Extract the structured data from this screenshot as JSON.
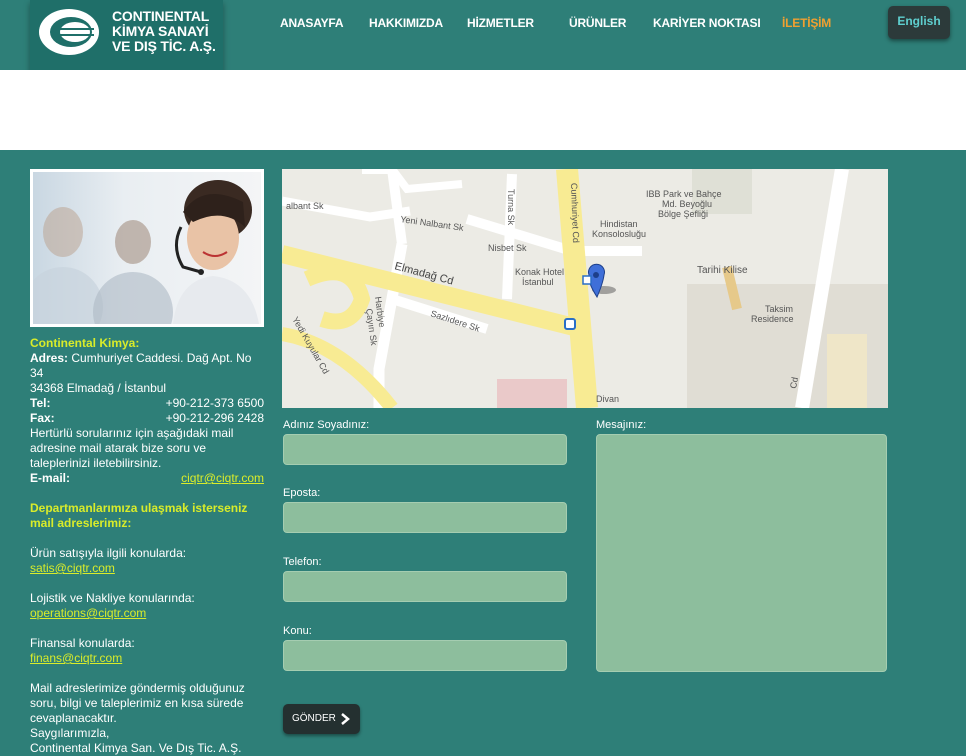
{
  "logo": {
    "line1": "CONTINENTAL",
    "line2": "KİMYA SANAYİ",
    "line3": "VE DIŞ TİC. A.Ş."
  },
  "nav": [
    {
      "label": "ANASAYFA",
      "active": false
    },
    {
      "label": "HAKKIMIZDA",
      "active": false
    },
    {
      "label": "HİZMETLER",
      "active": false
    },
    {
      "label": "ÜRÜNLER",
      "active": false
    },
    {
      "label": "KARİYER NOKTASI",
      "active": false
    },
    {
      "label": "İLETİŞİM",
      "active": true
    }
  ],
  "language_button": "English",
  "contact": {
    "company": "Continental Kimya:",
    "address_label": "Adres:",
    "address_line1": "Cumhuriyet Caddesi. Dağ Apt. No 34",
    "address_line2": "34368 Elmadağ / İstanbul",
    "tel_label": "Tel:",
    "tel": "+90-212-373 6500",
    "fax_label": "Fax:",
    "fax": "+90-212-296 2428",
    "info_text": "Hertürlü sorularınız için aşağıdaki mail adresine mail atarak bize soru ve taleplerinizi iletebilirsiniz.",
    "email_label": "E-mail:",
    "email": "ciqtr@ciqtr.com",
    "dept_heading": "Departmanlarımıza ulaşmak isterseniz mail adreslerimiz:",
    "sales_text": "Ürün satışıyla ilgili konularda:",
    "sales_email": "satis@ciqtr.com",
    "logistics_text": "Lojistik ve Nakliye konularında:",
    "logistics_email": "operations@ciqtr.com",
    "finance_text": "Finansal konularda:",
    "finance_email": "finans@ciqtr.com",
    "closing_text": "Mail adreslerimize göndermiş olduğunuz soru, bilgi ve taleplerimiz en kısa sürede cevaplanacaktır.",
    "signoff1": "Saygılarımızla,",
    "signoff2": "Continental Kimya San. Ve Dış Tic. A.Ş."
  },
  "map": {
    "labels": {
      "albant": "albant Sk",
      "yeni_nalbant": "Yeni Nalbant Sk",
      "turna": "Turna Sk",
      "cumhuriyet": "Cumhuriyet Cd",
      "nisbet": "Nisbet Sk",
      "hindistan1": "Hindistan",
      "hindistan2": "Konsolosluğu",
      "ibb1": "IBB Park ve Bahçe",
      "ibb2": "Md. Beyoğlu",
      "ibb3": "Bölge Şefliği",
      "elmadag": "Elmadağ Cd",
      "konak1": "Konak Hotel",
      "konak2": "İstanbul",
      "tarihi": "Tarihi Kilise",
      "sazlidere": "Sazlıdere Sk",
      "harbiye1": "Harbiye",
      "harbiye2": "Çayırı Sk",
      "yedi": "Yedi Kuyular Cd",
      "taksim1": "Taksim",
      "taksim2": "Residence",
      "divan": "Divan",
      "cd": "Cd"
    }
  },
  "form": {
    "name_label": "Adınız Soyadınız:",
    "email_label": "Eposta:",
    "phone_label": "Telefon:",
    "subject_label": "Konu:",
    "message_label": "Mesajınız:",
    "send_label": "GÖNDER"
  }
}
